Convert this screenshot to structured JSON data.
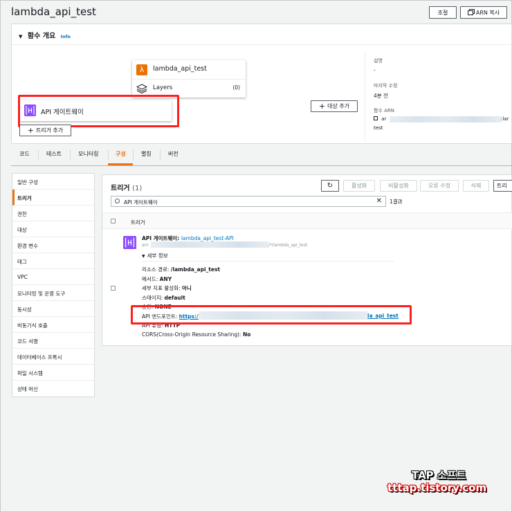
{
  "header": {
    "title": "lambda_api_test",
    "adjust_label": "조절",
    "copy_arn_label": "ARN 복사"
  },
  "overview": {
    "title": "함수 개요",
    "info": "Info",
    "function_name": "lambda_api_test",
    "layers_label": "Layers",
    "layers_count": "(0)",
    "trigger_name": "API 게이트웨이",
    "add_trigger": "트리거 추가",
    "add_destination": "대상 추가",
    "description_label": "설명",
    "description_value": "-",
    "last_modified_label": "마지막 수정",
    "last_modified_value": "4분 전",
    "arn_label": "함수 ARN",
    "arn_prefix": "ar",
    "arn_suffix": ":lar",
    "arn_last": "test"
  },
  "tabs": [
    "코드",
    "테스트",
    "모니터링",
    "구성",
    "별칭",
    "버전"
  ],
  "active_tab": "구성",
  "sidebar": [
    "일반 구성",
    "트리거",
    "권한",
    "대상",
    "환경 변수",
    "태그",
    "VPC",
    "모니터링 및 운영 도구",
    "동시성",
    "비동기식 호출",
    "코드 서명",
    "데이터베이스 프록시",
    "파일 시스템",
    "상태 머신"
  ],
  "triggers": {
    "title": "트리거",
    "count": "(1)",
    "buttons": [
      "활성화",
      "비활성화",
      "오류 수정",
      "삭제",
      "트리"
    ],
    "search_value": "API 게이트웨이",
    "result_count": "1결과",
    "column_header": "트리거",
    "row": {
      "name_prefix": "API 게이트웨이: ",
      "name_link": "lambda_api_test-API",
      "arn_prefix": "arn",
      "arn_suffix": "/*/lambda_api_test",
      "details_toggle": "세부 정보",
      "resource_path_label": "리소스 경로: ",
      "resource_path": "/lambda_api_test",
      "method_label": "메서드: ",
      "method": "ANY",
      "metrics_label": "세부 지표 활성화: ",
      "metrics": "아니",
      "stage_label": "스테이지: ",
      "stage": "default",
      "auth_label": "승인: ",
      "auth": "NONE",
      "endpoint_label": "API 엔드포인트: ",
      "endpoint_prefix": "https:/",
      "endpoint_suffix": "la_api_test",
      "api_type_label": "API 유형: ",
      "api_type": "HTTP",
      "cors_label": "CORS(Cross-Origin Resource Sharing): ",
      "cors": "No"
    }
  },
  "watermark": {
    "line1": "TAP 소프트",
    "line2": "tttap.tistory.com"
  },
  "colors": {
    "accent": "#ec7211",
    "link": "#0073bb",
    "highlight": "#ff1e1e",
    "lambda": "#ed7100",
    "apigw": "#8c4fff"
  }
}
